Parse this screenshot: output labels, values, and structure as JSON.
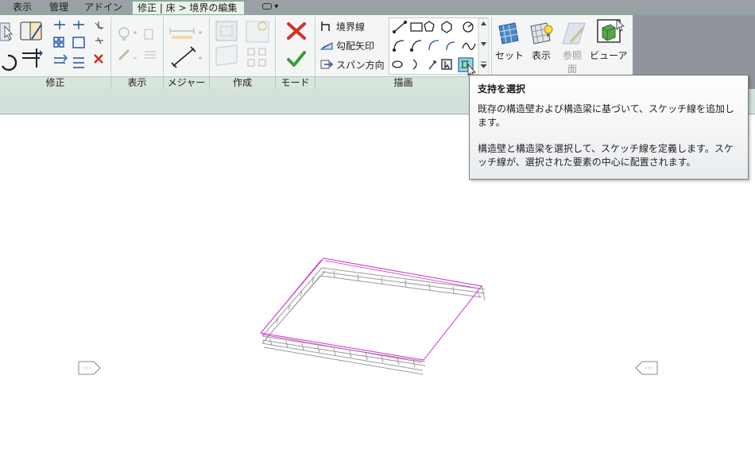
{
  "tabs": [
    {
      "label": "表示"
    },
    {
      "label": "管理"
    },
    {
      "label": "アドイン"
    },
    {
      "label": "修正 | 床 > 境界の編集",
      "active": true
    }
  ],
  "tab_dropdown": "▾",
  "groups": {
    "modify": "修正",
    "display": "表示",
    "measure": "メジャー",
    "create": "作成",
    "mode": "モード",
    "draw": "描画"
  },
  "draw_tools": {
    "boundary_line": "境界線",
    "slope_arrow": "勾配矢印",
    "span_direction": "スパン方向"
  },
  "right_panel": {
    "set": "セット",
    "show": "表示",
    "ref_plane_line1": "参照",
    "ref_plane_line2": "面",
    "viewer": "ビューア"
  },
  "tooltip": {
    "title": "支持を選択",
    "para1": "既存の構造壁および構造梁に基づいて、スケッチ線を追加します。",
    "para2": "構造壁と構造梁を選択して、スケッチ線を定義します。スケッチ線が、選択された要素の中心に配置されます。"
  },
  "colors": {
    "sketch_line": "#cc33cc",
    "cancel_x": "#d2302a",
    "finish_check": "#3d9a3a",
    "accent_green": "#7fb08e"
  }
}
